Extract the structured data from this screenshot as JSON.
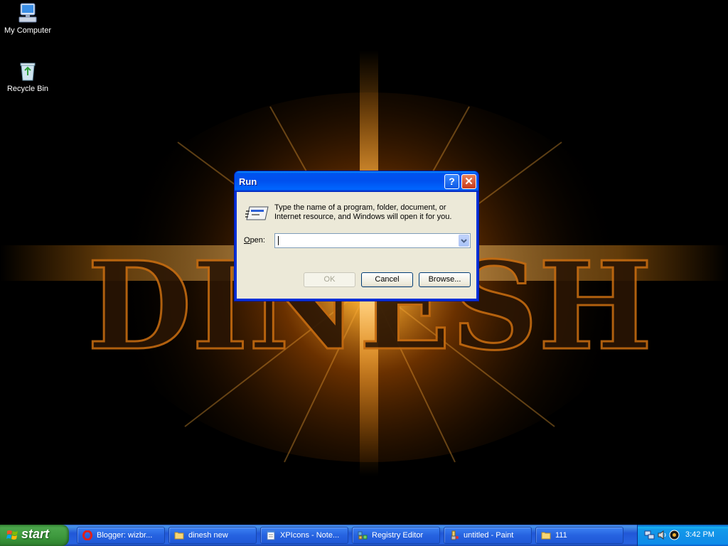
{
  "desktop": {
    "wallpaper_text": "DINESH",
    "icons": [
      {
        "label": "My Computer",
        "icon": "my-computer-icon"
      },
      {
        "label": "Recycle Bin",
        "icon": "recycle-bin-icon"
      }
    ]
  },
  "run_dialog": {
    "title": "Run",
    "help_glyph": "?",
    "close_glyph": "✕",
    "description": "Type the name of a program, folder, document, or Internet resource, and Windows will open it for you.",
    "open_label_accel": "O",
    "open_label_rest": "pen:",
    "open_value": "",
    "ok_label": "OK",
    "cancel_label": "Cancel",
    "browse_label": "Browse..."
  },
  "taskbar": {
    "start_label": "start",
    "tasks": [
      {
        "label": "Blogger: wizbr...",
        "icon": "opera-icon"
      },
      {
        "label": "dinesh new",
        "icon": "folder-icon"
      },
      {
        "label": "XPIcons - Note...",
        "icon": "notepad-icon"
      },
      {
        "label": "Registry Editor",
        "icon": "regedit-icon"
      },
      {
        "label": "untitled - Paint",
        "icon": "paint-icon"
      },
      {
        "label": "111",
        "icon": "folder-icon"
      }
    ],
    "clock": "3:42 PM"
  },
  "colors": {
    "accent_orange": "#ff9a1a",
    "dialog_face": "#ece9d8",
    "taskbar_blue": "#2663e0",
    "start_green": "#3c973c"
  }
}
